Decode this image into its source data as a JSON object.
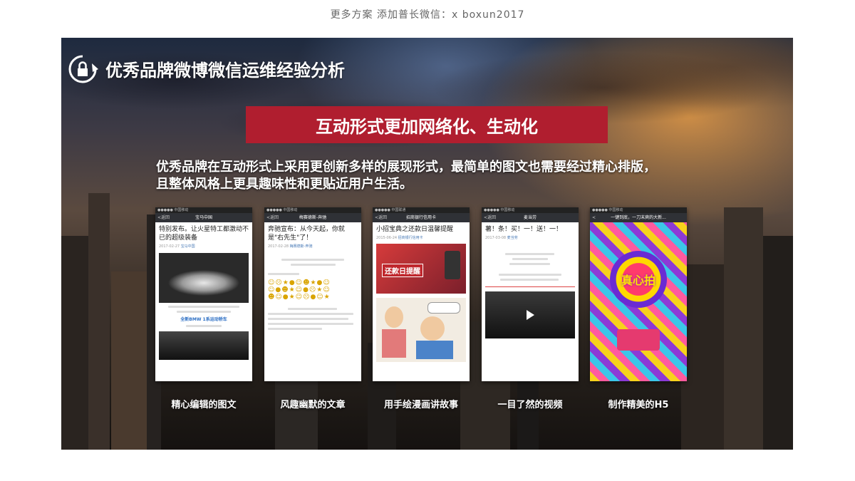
{
  "top_note": "更多方案 添加普长微信：x boxun2017",
  "slide": {
    "title": "优秀品牌微博微信运维经验分析",
    "banner": "互动形式更加网络化、生动化",
    "description_line1": "优秀品牌在互动形式上采用更创新多样的展现形式，最简单的图文也需要经过精心排版，",
    "description_line2": "且整体风格上更具趣味性和更贴近用户生活。"
  },
  "phones": [
    {
      "nav_title": "宝马中国",
      "post_title": "特别发布。让火星特工都激动不已的超级装备",
      "date": "2017-02-27",
      "account": "宝马中国",
      "caption": "精心编辑的图文",
      "inner_text_1": "全新BMW 1系运动轿车"
    },
    {
      "nav_title": "梅赛德斯-奔驰",
      "post_title": "奔驰宣布：从今天起，你就是\"右先生\"了！",
      "date": "2017-02-28",
      "account": "梅赛德斯-奔驰",
      "caption": "风趣幽默的文章"
    },
    {
      "nav_title": "招商银行信用卡",
      "post_title": "小招宝典之还款日温馨提醒",
      "date": "2015-06-24",
      "account": "招商银行信用卡",
      "caption": "用手绘漫画讲故事",
      "inner_text_1": "还款日提醒"
    },
    {
      "nav_title": "麦当劳",
      "post_title": "薯！条！买！一！送！一！",
      "date": "2017-03-08",
      "account": "麦当劳",
      "caption": "一目了然的视频"
    },
    {
      "nav_title": "一键到底，一刀末爽的大新...",
      "caption": "制作精美的H5",
      "inner_text_1": "真心拍"
    }
  ],
  "colors": {
    "banner": "#b01e2f",
    "nav_bar": "#2f3136",
    "link": "#4a7bb7"
  },
  "icons": {
    "logo": "lock-refresh-icon",
    "play": "play-icon"
  }
}
